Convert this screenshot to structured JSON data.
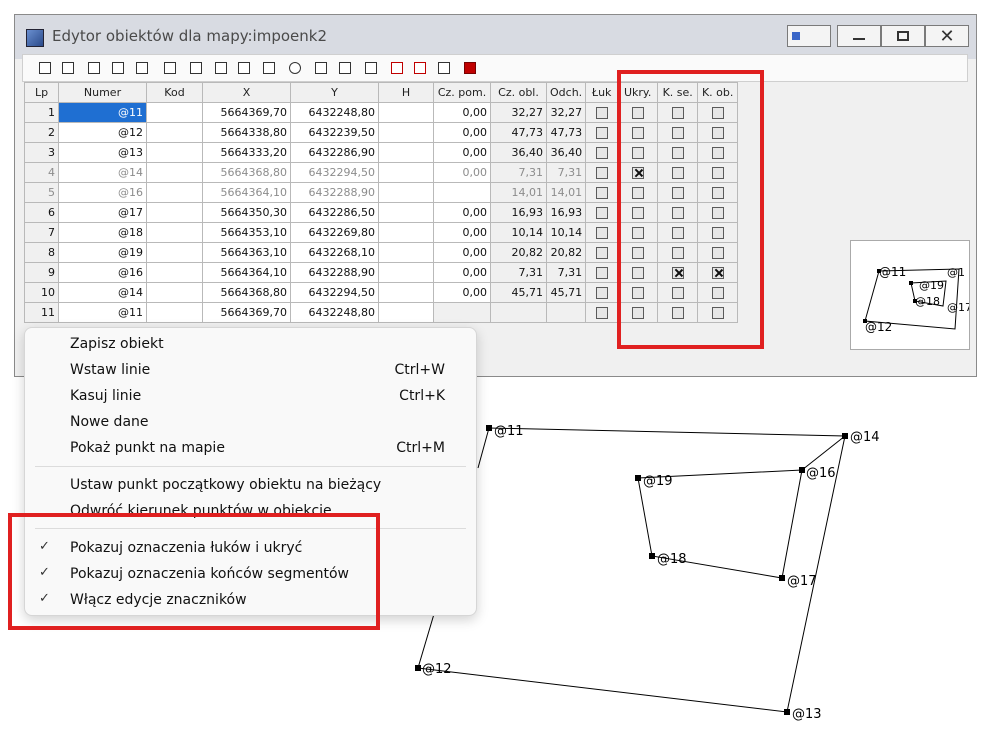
{
  "window": {
    "title": "Edytor obiektów dla mapy:impoenk2",
    "controls": [
      "minimize",
      "maximize",
      "close"
    ]
  },
  "toolbar": {
    "buttons": [
      "new-icon",
      "save-icon",
      "list-icon",
      "print-icon",
      "align-icon",
      "copy-icon",
      "swap-icon",
      "window-icon",
      "calc-icon",
      "pencil-icon",
      "down-icon",
      "txt-export-icon",
      "txt-import-icon",
      "search-icon",
      "up-icon",
      "flag-icon",
      "height-icon",
      "exit-icon"
    ]
  },
  "grid": {
    "headers": [
      "Lp",
      "Numer",
      "Kod",
      "X",
      "Y",
      "H",
      "Cz. pom.",
      "Cz. obl.",
      "Odch.",
      "Łuk",
      "Ukry.",
      "K. se.",
      "K. ob."
    ],
    "rows": [
      {
        "lp": "1",
        "numer": "@11",
        "kod": "",
        "x": "5664369,70",
        "y": "6432248,80",
        "h": "",
        "czpom": "0,00",
        "czobl": "32,27",
        "odch": "32,27",
        "luk": false,
        "ukry": false,
        "kse": false,
        "kob": false
      },
      {
        "lp": "2",
        "numer": "@12",
        "kod": "",
        "x": "5664338,80",
        "y": "6432239,50",
        "h": "",
        "czpom": "0,00",
        "czobl": "47,73",
        "odch": "47,73",
        "luk": false,
        "ukry": false,
        "kse": false,
        "kob": false
      },
      {
        "lp": "3",
        "numer": "@13",
        "kod": "",
        "x": "5664333,20",
        "y": "6432286,90",
        "h": "",
        "czpom": "0,00",
        "czobl": "36,40",
        "odch": "36,40",
        "luk": false,
        "ukry": false,
        "kse": false,
        "kob": false
      },
      {
        "lp": "4",
        "numer": "@14",
        "kod": "",
        "x": "5664368,80",
        "y": "6432294,50",
        "h": "",
        "czpom": "0,00",
        "czobl": "7,31",
        "odch": "7,31",
        "luk": false,
        "ukry": true,
        "kse": false,
        "kob": false
      },
      {
        "lp": "5",
        "numer": "@16",
        "kod": "",
        "x": "5664364,10",
        "y": "6432288,90",
        "h": "",
        "czpom": "",
        "czobl": "14,01",
        "odch": "14,01",
        "luk": false,
        "ukry": false,
        "kse": false,
        "kob": false
      },
      {
        "lp": "6",
        "numer": "@17",
        "kod": "",
        "x": "5664350,30",
        "y": "6432286,50",
        "h": "",
        "czpom": "0,00",
        "czobl": "16,93",
        "odch": "16,93",
        "luk": false,
        "ukry": false,
        "kse": false,
        "kob": false
      },
      {
        "lp": "7",
        "numer": "@18",
        "kod": "",
        "x": "5664353,10",
        "y": "6432269,80",
        "h": "",
        "czpom": "0,00",
        "czobl": "10,14",
        "odch": "10,14",
        "luk": false,
        "ukry": false,
        "kse": false,
        "kob": false
      },
      {
        "lp": "8",
        "numer": "@19",
        "kod": "",
        "x": "5664363,10",
        "y": "6432268,10",
        "h": "",
        "czpom": "0,00",
        "czobl": "20,82",
        "odch": "20,82",
        "luk": false,
        "ukry": false,
        "kse": false,
        "kob": false
      },
      {
        "lp": "9",
        "numer": "@16",
        "kod": "",
        "x": "5664364,10",
        "y": "6432288,90",
        "h": "",
        "czpom": "0,00",
        "czobl": "7,31",
        "odch": "7,31",
        "luk": false,
        "ukry": false,
        "kse": true,
        "kob": true
      },
      {
        "lp": "10",
        "numer": "@14",
        "kod": "",
        "x": "5664368,80",
        "y": "6432294,50",
        "h": "",
        "czpom": "0,00",
        "czobl": "45,71",
        "odch": "45,71",
        "luk": false,
        "ukry": false,
        "kse": false,
        "kob": false
      },
      {
        "lp": "11",
        "numer": "@11",
        "kod": "",
        "x": "5664369,70",
        "y": "6432248,80",
        "h": "",
        "czpom": "",
        "czobl": "",
        "odch": "",
        "luk": false,
        "ukry": false,
        "kse": false,
        "kob": false
      }
    ]
  },
  "context_menu": {
    "items": [
      {
        "label": "Zapisz obiekt",
        "shortcut": ""
      },
      {
        "label": "Wstaw linie",
        "shortcut": "Ctrl+W"
      },
      {
        "label": "Kasuj linie",
        "shortcut": "Ctrl+K"
      },
      {
        "label": "Nowe dane",
        "shortcut": ""
      },
      {
        "label": "Pokaż punkt na mapie",
        "shortcut": "Ctrl+M"
      },
      {
        "label": "Ustaw punkt początkowy obiektu na bieżący",
        "shortcut": ""
      },
      {
        "label": "Odwróć kierunek punktów w obiekcie",
        "shortcut": ""
      },
      {
        "label": "Pokazuj oznaczenia łuków i ukryć",
        "shortcut": "",
        "checked": true
      },
      {
        "label": "Pokazuj oznaczenia końców segmentów",
        "shortcut": "",
        "checked": true
      },
      {
        "label": "Włącz edycje znaczników",
        "shortcut": "",
        "checked": true
      }
    ]
  },
  "map": {
    "point_labels": [
      "@11",
      "@14",
      "@16",
      "@19",
      "@18",
      "@17",
      "@12",
      "@13"
    ]
  },
  "minimap": {
    "labels": [
      "@11",
      "@19",
      "@18",
      "@12",
      "@17",
      "@1"
    ]
  },
  "colors": {
    "highlight": "#e02020",
    "selection": "#1f6fd2"
  }
}
